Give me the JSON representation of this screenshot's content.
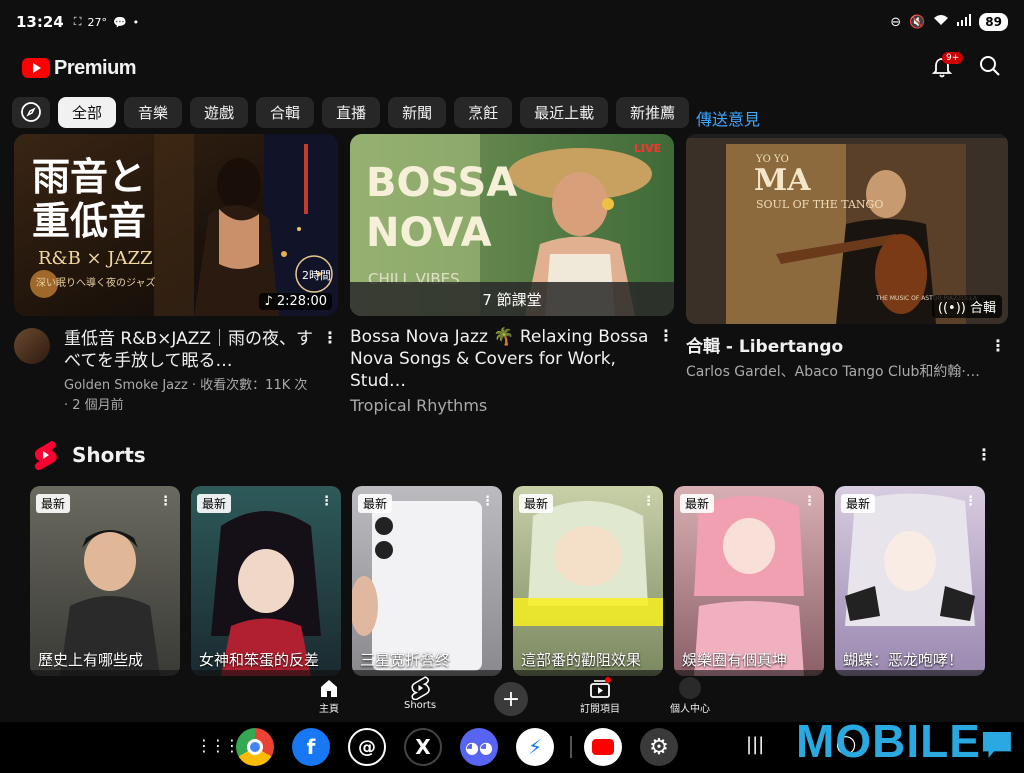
{
  "status": {
    "time": "13:24",
    "temp": "27°",
    "battery": "89"
  },
  "app": {
    "logo_text": "Premium",
    "notif_count": "9+"
  },
  "chips": [
    "全部",
    "音樂",
    "遊戲",
    "合輯",
    "直播",
    "新聞",
    "烹飪",
    "最近上載",
    "新推薦"
  ],
  "feedback": "傳送意見",
  "videos": [
    {
      "title": "重低音 R&B×JAZZ｜雨の夜、すべてを手放して眠る…",
      "channel": "Golden Smoke Jazz · 收看次數：11K 次 · 2 個月前",
      "duration": "2:28:00",
      "thumb_text1": "雨音と",
      "thumb_text2": "重低音",
      "thumb_text3": "R&B × JAZZ",
      "thumb_text4": "深い眠りへ導く夜のジャズ",
      "thumb_text5": "2時間"
    },
    {
      "title": "Bossa Nova Jazz 🌴 Relaxing Bossa Nova Songs & Covers for Work, Stud…",
      "channel": "Tropical Rhythms",
      "lessons": "7 節課堂",
      "thumb_text1": "BOSSA",
      "thumb_text2": "NOVA",
      "thumb_text3": "CHILL VIBES",
      "thumb_text4": "LIVE"
    },
    {
      "title": "合輯 - Libertango",
      "channel": "Carlos Gardel、Abaco Tango Club和約翰·…",
      "badge": "合輯",
      "thumb_text1": "YO YO",
      "thumb_text2": "MA",
      "thumb_text3": "SOUL OF THE TANGO",
      "thumb_text4": "THE MUSIC OF ASTOR PIAZZOLLA"
    }
  ],
  "shorts": {
    "heading": "Shorts",
    "new_label": "最新",
    "items": [
      {
        "title": "歷史上有哪些成",
        "bg": "#5a5a52"
      },
      {
        "title": "女神和笨蛋的反差",
        "bg": "#3c3540"
      },
      {
        "title": "三星宽折叠终",
        "bg": "#cfcfd3"
      },
      {
        "title": "這部番的勸阻效果",
        "bg": "#a8b48a"
      },
      {
        "title": "娛樂圈有個真坤",
        "bg": "#c8a4a8"
      },
      {
        "title": "蝴蝶：恶龙咆哮！",
        "bg": "#b8a8c8"
      }
    ]
  },
  "nav": {
    "home": "主頁",
    "shorts": "Shorts",
    "subscriptions": "訂閱項目",
    "you": "個人中心"
  },
  "watermark": "MOBILE"
}
